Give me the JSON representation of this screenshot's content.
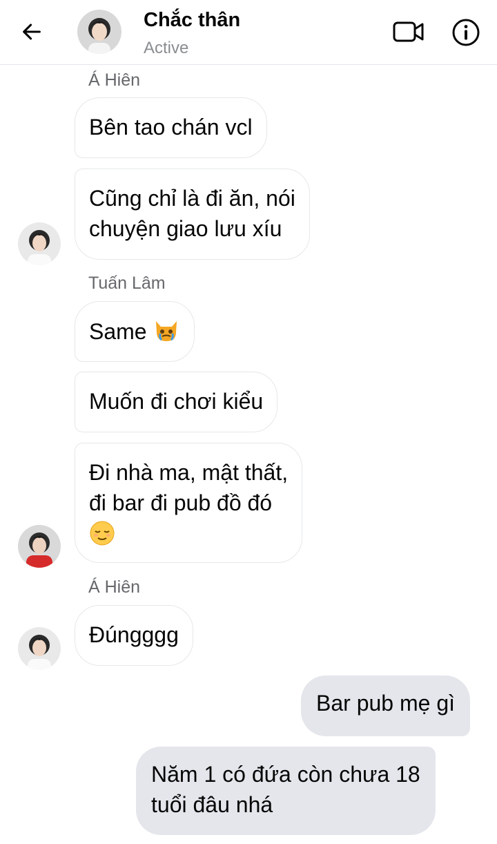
{
  "header": {
    "title": "Chắc thân",
    "status": "Active",
    "back_icon": "arrow-left-icon",
    "video_icon": "video-call-icon",
    "info_icon": "info-icon"
  },
  "messages": [
    {
      "sender": "Á Hiên"
    },
    {
      "text": "Bên tao chán vcl"
    },
    {
      "line1": "Cũng chỉ là đi ăn, nói",
      "line2": "chuyện giao lưu xíu"
    },
    {
      "sender": "Tuấn Lâm"
    },
    {
      "text": "Same",
      "emoji": "crying-cat-emoji"
    },
    {
      "text": "Muốn đi chơi kiểu"
    },
    {
      "line1": "Đi nhà ma, mật thất,",
      "line2": "đi bar đi pub đồ đó",
      "emoji": "relieved-face-emoji"
    },
    {
      "sender": "Á Hiên"
    },
    {
      "text": "Đúngggg"
    }
  ],
  "outgoing": [
    {
      "text": "Bar pub mẹ gì"
    },
    {
      "line1": "Năm 1 có đứa còn chưa 18",
      "line2": "tuổi đâu nhá"
    }
  ],
  "colors": {
    "incoming_bubble": "#ffffff",
    "outgoing_bubble": "#e4e6eb",
    "secondary_text": "#65676b",
    "header_status": "#8a8d91"
  }
}
